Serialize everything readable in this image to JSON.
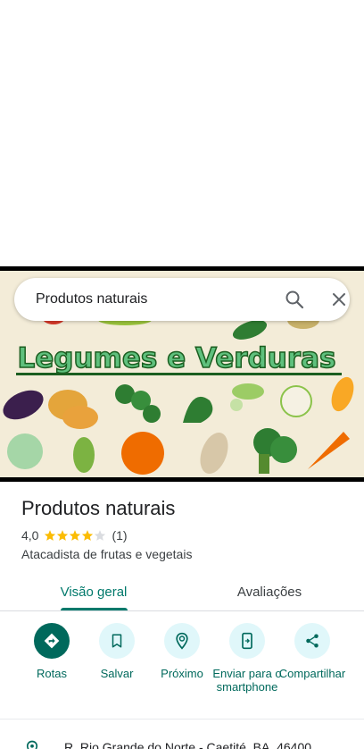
{
  "search": {
    "query": "Produtos naturais"
  },
  "photo": {
    "banner_text": "Legumes e Verduras"
  },
  "place": {
    "title": "Produtos naturais",
    "rating": "4,0",
    "stars": 4,
    "review_count": "(1)",
    "category": "Atacadista de frutas e vegetais",
    "address": "R. Rio Grande do Norte - Caetité, BA, 46400"
  },
  "tabs": [
    {
      "label": "Visão geral",
      "active": true
    },
    {
      "label": "Avaliações",
      "active": false
    }
  ],
  "actions": [
    {
      "label": "Rotas",
      "icon": "directions-icon"
    },
    {
      "label": "Salvar",
      "icon": "bookmark-icon"
    },
    {
      "label": "Próximo",
      "icon": "nearby-icon"
    },
    {
      "label": "Enviar para o smartphone",
      "icon": "send-to-phone-icon"
    },
    {
      "label": "Compartilhar",
      "icon": "share-icon"
    }
  ],
  "colors": {
    "accent": "#00796b",
    "star": "#fbbc04",
    "action_bg": "#e0f7fa"
  }
}
